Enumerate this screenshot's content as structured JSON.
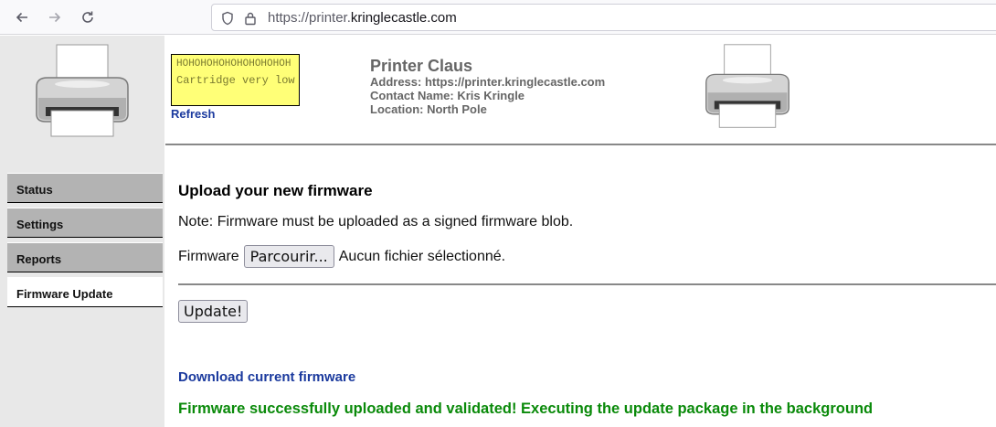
{
  "browser": {
    "url_prefix": "https://printer.",
    "url_host": "kringlecastle.com"
  },
  "sidebar": {
    "items": [
      {
        "label": "Status"
      },
      {
        "label": "Settings"
      },
      {
        "label": "Reports"
      },
      {
        "label": "Firmware Update",
        "active": true
      }
    ]
  },
  "header": {
    "status_banner": "HOHOHOHOHOHOHOHOHOH",
    "status_message": "Cartridge very low",
    "refresh_label": "Refresh",
    "printer_name": "Printer Claus",
    "address": "Address: https://printer.kringlecastle.com",
    "contact": "Contact Name: Kris Kringle",
    "location": "Location: North Pole"
  },
  "main": {
    "title": "Upload your new firmware",
    "note": "Note: Firmware must be uploaded as a signed firmware blob.",
    "firmware_label": "Firmware",
    "browse_label": "Parcourir...",
    "no_file_text": "Aucun fichier sélectionné.",
    "update_label": "Update!",
    "download_label": "Download current firmware",
    "success_message": "Firmware successfully uploaded and validated! Executing the update package in the background"
  },
  "colors": {
    "link": "#1b3a9e",
    "success": "#0a8a0a",
    "status_box": "#ffff77",
    "menu": "#b3b3b3"
  }
}
